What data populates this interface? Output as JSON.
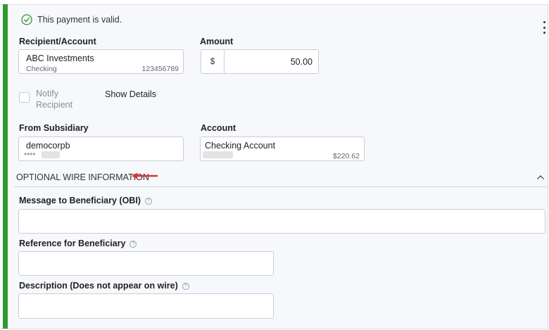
{
  "validation": {
    "message": "This payment is valid."
  },
  "recipient": {
    "label": "Recipient/Account",
    "name": "ABC Investments",
    "type": "Checking",
    "account_number": "123456789"
  },
  "amount": {
    "label": "Amount",
    "currency": "$",
    "value": "50.00"
  },
  "notify": {
    "label_line1": "Notify",
    "label_line2": "Recipient",
    "checked": false
  },
  "show_details": {
    "label": "Show Details"
  },
  "from_subsidiary": {
    "label": "From Subsidiary",
    "name": "democorpb",
    "masked": "****"
  },
  "account": {
    "label": "Account",
    "name": "Checking Account",
    "balance": "$220.62"
  },
  "optional_section": {
    "title": "OPTIONAL WIRE INFORMATION",
    "expanded": true
  },
  "fields": {
    "message": {
      "label": "Message to Beneficiary (OBI)",
      "value": ""
    },
    "reference": {
      "label": "Reference for Beneficiary",
      "value": ""
    },
    "description": {
      "label": "Description (Does not appear on wire)",
      "value": ""
    }
  },
  "icons": {
    "valid": "check-circle-icon",
    "menu": "kebab-menu-icon",
    "collapse": "chevron-up-icon",
    "help": "question-circle-icon",
    "annotation": "red-arrow-icon"
  },
  "colors": {
    "valid_bar": "#2f9b2f",
    "annotation": "#e0302f"
  }
}
